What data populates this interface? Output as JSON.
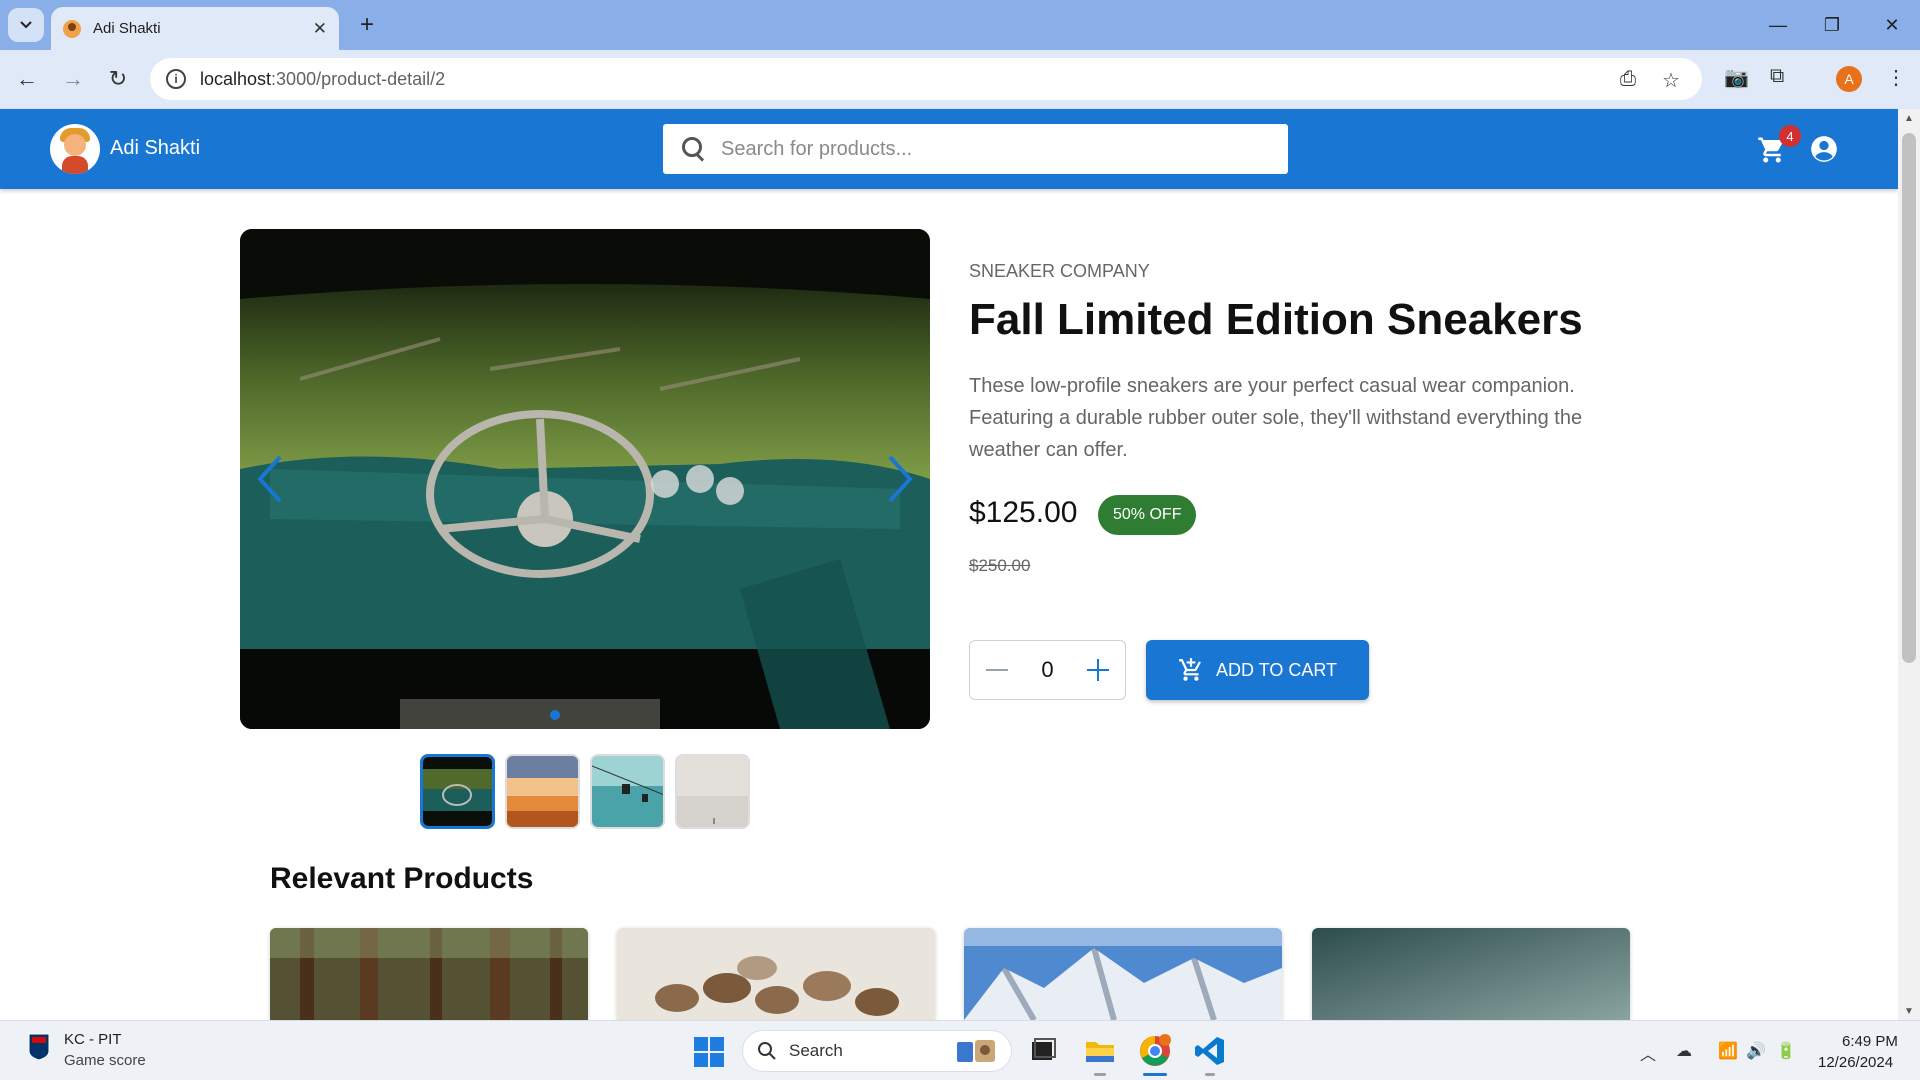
{
  "browser": {
    "tab_title": "Adi Shakti",
    "url_host": "localhost",
    "url_path": ":3000/product-detail/2",
    "window_controls": [
      "minimize",
      "restore",
      "close"
    ]
  },
  "header": {
    "brand": "Adi Shakti",
    "search_placeholder": "Search for products...",
    "cart_count": "4"
  },
  "product": {
    "company": "SNEAKER COMPANY",
    "title": "Fall Limited Edition Sneakers",
    "description": "These low-profile sneakers are your perfect casual wear companion. Featuring a durable rubber outer sole, they'll withstand everything the weather can offer.",
    "price": "$125.00",
    "discount": "50% OFF",
    "original_price": "$250.00",
    "quantity": "0",
    "add_to_cart": "ADD TO CART",
    "gallery": {
      "active_index": 0,
      "images": [
        "car-interior",
        "sunset-clouds",
        "cable-car",
        "misty-sky"
      ]
    }
  },
  "relevant": {
    "heading": "Relevant Products",
    "cards": [
      "forest",
      "coffee-beans",
      "mountains",
      "teal-sky"
    ]
  },
  "taskbar": {
    "news_title": "KC - PIT",
    "news_subtitle": "Game score",
    "search_label": "Search",
    "time": "6:49 PM",
    "date": "12/26/2024"
  },
  "colors": {
    "primary": "#1976d2",
    "discount_bg": "#2e7d32",
    "badge": "#d32f2f"
  }
}
